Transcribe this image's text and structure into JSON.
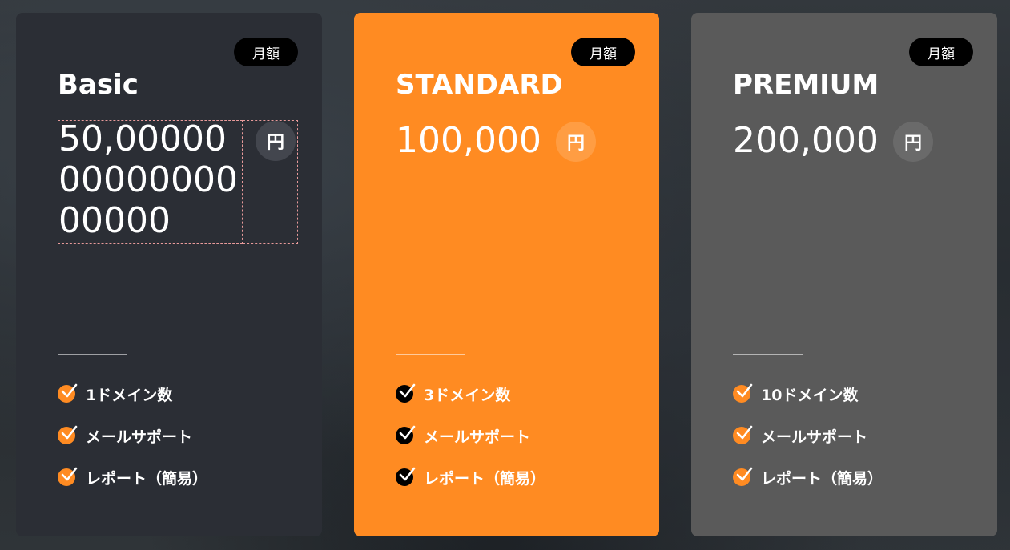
{
  "plans": [
    {
      "name": "Basic",
      "badge": "月額",
      "price": "50,000000000000000000",
      "currency": "円",
      "features": [
        "1ドメイン数",
        "メールサポート",
        "レポート（簡易）"
      ]
    },
    {
      "name": "STANDARD",
      "badge": "月額",
      "price": "100,000",
      "currency": "円",
      "features": [
        "3ドメイン数",
        "メールサポート",
        "レポート（簡易）"
      ]
    },
    {
      "name": "PREMIUM",
      "badge": "月額",
      "price": "200,000",
      "currency": "円",
      "features": [
        "10ドメイン数",
        "メールサポート",
        "レポート（簡易）"
      ]
    }
  ],
  "colors": {
    "basic_bg": "#2b2e35",
    "standard_bg": "#ff8b22",
    "premium_bg": "#5a5a5a",
    "accent": "#ff8b22"
  },
  "icons": {
    "check": "check-circle-icon"
  }
}
